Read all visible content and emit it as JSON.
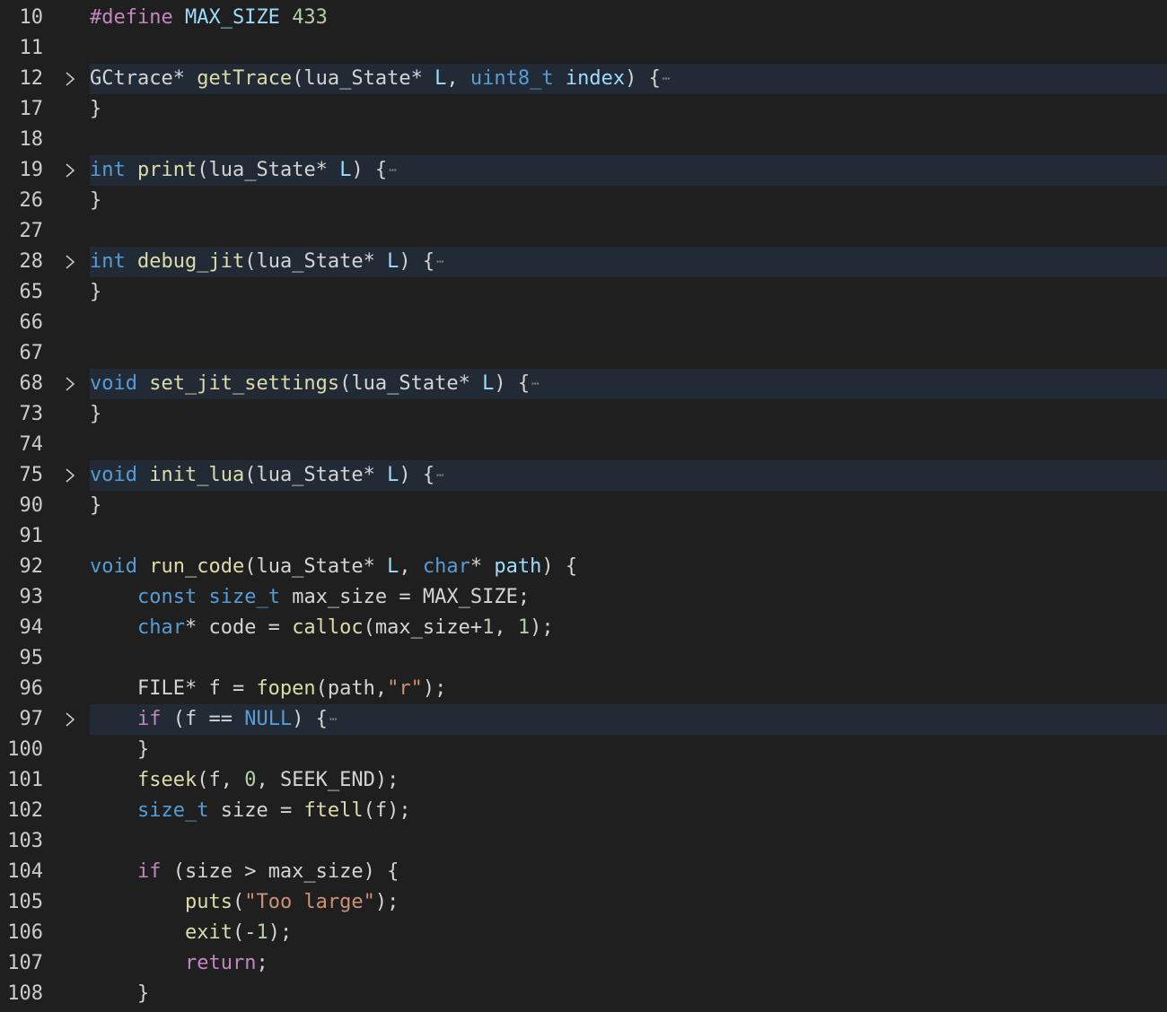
{
  "editor": {
    "language": "c",
    "colors": {
      "background": "#1f1f1f",
      "folded_line_highlight": "#222b35",
      "line_number": "#cccccc",
      "keyword": "#569cd6",
      "control_keyword": "#c586c0",
      "function": "#dcdcaa",
      "parameter": "#9cdcfe",
      "number": "#b5cea8",
      "string": "#ce9178",
      "text": "#d4d4d4"
    },
    "fold_icon": "chevron-right-icon",
    "folded_placeholder": "⋯",
    "lines": [
      {
        "num": "10",
        "folded": false,
        "tokens": [
          [
            "dir",
            "#define"
          ],
          [
            "plain",
            " "
          ],
          [
            "var",
            "MAX_SIZE"
          ],
          [
            "plain",
            " "
          ],
          [
            "num",
            "433"
          ]
        ]
      },
      {
        "num": "11",
        "folded": false,
        "tokens": []
      },
      {
        "num": "12",
        "folded": true,
        "tokens": [
          [
            "plain",
            "GCtrace* "
          ],
          [
            "fn",
            "getTrace"
          ],
          [
            "plain",
            "(lua_State* "
          ],
          [
            "var",
            "L"
          ],
          [
            "plain",
            ", "
          ],
          [
            "kw",
            "uint8_t"
          ],
          [
            "plain",
            " "
          ],
          [
            "var",
            "index"
          ],
          [
            "plain",
            ") {"
          ]
        ]
      },
      {
        "num": "17",
        "folded": false,
        "tokens": [
          [
            "plain",
            "}"
          ]
        ]
      },
      {
        "num": "18",
        "folded": false,
        "tokens": []
      },
      {
        "num": "19",
        "folded": true,
        "tokens": [
          [
            "kw",
            "int"
          ],
          [
            "plain",
            " "
          ],
          [
            "fn",
            "print"
          ],
          [
            "plain",
            "(lua_State* "
          ],
          [
            "var",
            "L"
          ],
          [
            "plain",
            ") {"
          ]
        ]
      },
      {
        "num": "26",
        "folded": false,
        "tokens": [
          [
            "plain",
            "}"
          ]
        ]
      },
      {
        "num": "27",
        "folded": false,
        "tokens": []
      },
      {
        "num": "28",
        "folded": true,
        "tokens": [
          [
            "kw",
            "int"
          ],
          [
            "plain",
            " "
          ],
          [
            "fn",
            "debug_jit"
          ],
          [
            "plain",
            "(lua_State* "
          ],
          [
            "var",
            "L"
          ],
          [
            "plain",
            ") {"
          ]
        ]
      },
      {
        "num": "65",
        "folded": false,
        "tokens": [
          [
            "plain",
            "}"
          ]
        ]
      },
      {
        "num": "66",
        "folded": false,
        "tokens": []
      },
      {
        "num": "67",
        "folded": false,
        "tokens": []
      },
      {
        "num": "68",
        "folded": true,
        "tokens": [
          [
            "kw",
            "void"
          ],
          [
            "plain",
            " "
          ],
          [
            "fn",
            "set_jit_settings"
          ],
          [
            "plain",
            "(lua_State* "
          ],
          [
            "var",
            "L"
          ],
          [
            "plain",
            ") {"
          ]
        ]
      },
      {
        "num": "73",
        "folded": false,
        "tokens": [
          [
            "plain",
            "}"
          ]
        ]
      },
      {
        "num": "74",
        "folded": false,
        "tokens": []
      },
      {
        "num": "75",
        "folded": true,
        "tokens": [
          [
            "kw",
            "void"
          ],
          [
            "plain",
            " "
          ],
          [
            "fn",
            "init_lua"
          ],
          [
            "plain",
            "(lua_State* "
          ],
          [
            "var",
            "L"
          ],
          [
            "plain",
            ") {"
          ]
        ]
      },
      {
        "num": "90",
        "folded": false,
        "tokens": [
          [
            "plain",
            "}"
          ]
        ]
      },
      {
        "num": "91",
        "folded": false,
        "tokens": []
      },
      {
        "num": "92",
        "folded": false,
        "tokens": [
          [
            "kw",
            "void"
          ],
          [
            "plain",
            " "
          ],
          [
            "fn",
            "run_code"
          ],
          [
            "plain",
            "(lua_State* "
          ],
          [
            "var",
            "L"
          ],
          [
            "plain",
            ", "
          ],
          [
            "kw",
            "char"
          ],
          [
            "plain",
            "* "
          ],
          [
            "var",
            "path"
          ],
          [
            "plain",
            ") {"
          ]
        ]
      },
      {
        "num": "93",
        "folded": false,
        "tokens": [
          [
            "plain",
            "    "
          ],
          [
            "kw",
            "const"
          ],
          [
            "plain",
            " "
          ],
          [
            "kw",
            "size_t"
          ],
          [
            "plain",
            " max_size = MAX_SIZE;"
          ]
        ]
      },
      {
        "num": "94",
        "folded": false,
        "tokens": [
          [
            "plain",
            "    "
          ],
          [
            "kw",
            "char"
          ],
          [
            "plain",
            "* code = "
          ],
          [
            "fn",
            "calloc"
          ],
          [
            "plain",
            "(max_size+"
          ],
          [
            "num",
            "1"
          ],
          [
            "plain",
            ", "
          ],
          [
            "num",
            "1"
          ],
          [
            "plain",
            ");"
          ]
        ]
      },
      {
        "num": "95",
        "folded": false,
        "tokens": []
      },
      {
        "num": "96",
        "folded": false,
        "tokens": [
          [
            "plain",
            "    FILE* f = "
          ],
          [
            "fn",
            "fopen"
          ],
          [
            "plain",
            "(path,"
          ],
          [
            "str",
            "\"r\""
          ],
          [
            "plain",
            ");"
          ]
        ]
      },
      {
        "num": "97",
        "folded": true,
        "tokens": [
          [
            "plain",
            "    "
          ],
          [
            "ctl",
            "if"
          ],
          [
            "plain",
            " (f == "
          ],
          [
            "kw",
            "NULL"
          ],
          [
            "plain",
            ") {"
          ]
        ]
      },
      {
        "num": "100",
        "folded": false,
        "tokens": [
          [
            "plain",
            "    }"
          ]
        ]
      },
      {
        "num": "101",
        "folded": false,
        "tokens": [
          [
            "plain",
            "    "
          ],
          [
            "fn",
            "fseek"
          ],
          [
            "plain",
            "(f, "
          ],
          [
            "num",
            "0"
          ],
          [
            "plain",
            ", SEEK_END);"
          ]
        ]
      },
      {
        "num": "102",
        "folded": false,
        "tokens": [
          [
            "plain",
            "    "
          ],
          [
            "kw",
            "size_t"
          ],
          [
            "plain",
            " size = "
          ],
          [
            "fn",
            "ftell"
          ],
          [
            "plain",
            "(f);"
          ]
        ]
      },
      {
        "num": "103",
        "folded": false,
        "tokens": []
      },
      {
        "num": "104",
        "folded": false,
        "tokens": [
          [
            "plain",
            "    "
          ],
          [
            "ctl",
            "if"
          ],
          [
            "plain",
            " (size > max_size) {"
          ]
        ]
      },
      {
        "num": "105",
        "folded": false,
        "tokens": [
          [
            "plain",
            "        "
          ],
          [
            "fn",
            "puts"
          ],
          [
            "plain",
            "("
          ],
          [
            "str",
            "\"Too large\""
          ],
          [
            "plain",
            ");"
          ]
        ]
      },
      {
        "num": "106",
        "folded": false,
        "tokens": [
          [
            "plain",
            "        "
          ],
          [
            "fn",
            "exit"
          ],
          [
            "plain",
            "(-"
          ],
          [
            "num",
            "1"
          ],
          [
            "plain",
            ");"
          ]
        ]
      },
      {
        "num": "107",
        "folded": false,
        "tokens": [
          [
            "plain",
            "        "
          ],
          [
            "ctl",
            "return"
          ],
          [
            "plain",
            ";"
          ]
        ]
      },
      {
        "num": "108",
        "folded": false,
        "tokens": [
          [
            "plain",
            "    }"
          ]
        ]
      }
    ]
  }
}
